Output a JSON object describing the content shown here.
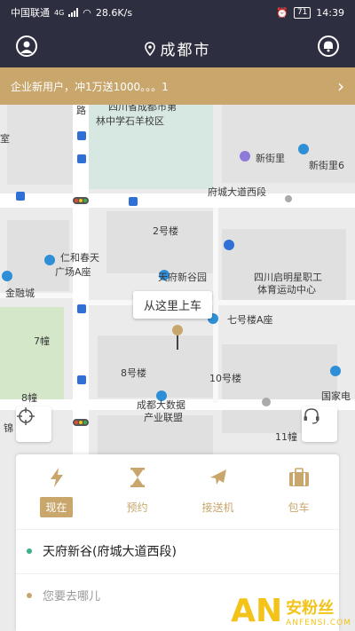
{
  "status": {
    "carrier": "中国联通",
    "network": "4G",
    "speed": "28.6K/s",
    "battery": "71",
    "time": "14:39"
  },
  "header": {
    "city": "成都市"
  },
  "promo": {
    "text": "企业新用户，冲1万送1000。。。1"
  },
  "map": {
    "pickup_label": "从这里上车",
    "labels": [
      "四川省成都市第",
      "林中学石羊校区",
      "新街里",
      "新街里6",
      "府城大道西段",
      "路",
      "2号楼",
      "仁和春天",
      "广场A座",
      "金融城",
      "天府新谷园",
      "四川启明星职工",
      "体育运动中心",
      "七号楼A座",
      "8号楼",
      "10号楼",
      "成都大数据",
      "产业联盟",
      "国家电",
      "7幢",
      "8幢",
      "11幢",
      "锦",
      "室"
    ]
  },
  "panel": {
    "tabs": [
      {
        "label": "现在",
        "icon": "lightning-icon"
      },
      {
        "label": "预约",
        "icon": "hourglass-icon"
      },
      {
        "label": "接送机",
        "icon": "airplane-icon"
      },
      {
        "label": "包车",
        "icon": "briefcase-icon"
      }
    ],
    "pickup": "天府新谷(府城大道西段)",
    "destination_placeholder": "您要去哪儿"
  },
  "watermark": {
    "logo": "AN",
    "cn": "安粉丝",
    "en": "ANFENSI.COM"
  },
  "colors": {
    "accent": "#c8a66c",
    "header": "#2d2e3f",
    "pickup_dot": "#39b08a",
    "dest_dot": "#c8a66c"
  }
}
